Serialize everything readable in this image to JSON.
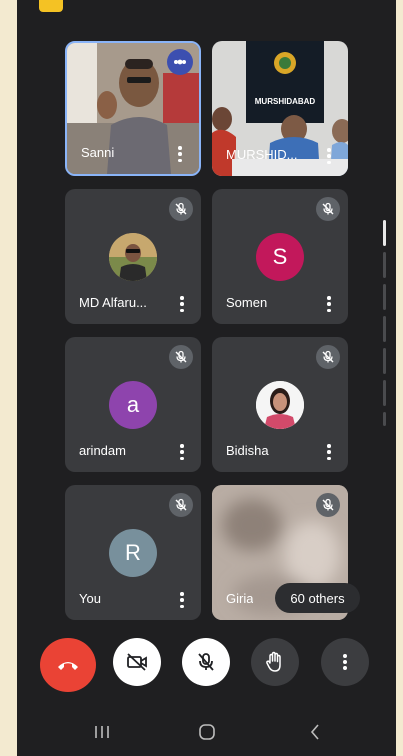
{
  "participants": [
    {
      "name": "Sanni",
      "type": "video",
      "speaking": true
    },
    {
      "name": "MURSHID...",
      "type": "video",
      "sign_text": "MURSHIDABAD"
    },
    {
      "name": "MD Alfaru...",
      "type": "photo",
      "muted": true
    },
    {
      "name": "Somen",
      "type": "initial",
      "initial": "S",
      "color": "#c2185b",
      "muted": true
    },
    {
      "name": "arindam",
      "type": "initial",
      "initial": "a",
      "color": "#8e44ad",
      "muted": true
    },
    {
      "name": "Bidisha",
      "type": "photo",
      "muted": true
    },
    {
      "name": "You",
      "type": "initial",
      "initial": "R",
      "color": "#78909c",
      "muted": true
    },
    {
      "name": "Giria",
      "type": "video",
      "muted": true
    }
  ],
  "others_label": "60 others",
  "controls": [
    "end-call",
    "camera-off",
    "mic-off",
    "raise-hand",
    "more-options"
  ],
  "colors": {
    "background": "#1f1f21",
    "tile": "#3a3b3e",
    "end_call": "#ea4335",
    "speaking_border": "#8ab4f8"
  }
}
